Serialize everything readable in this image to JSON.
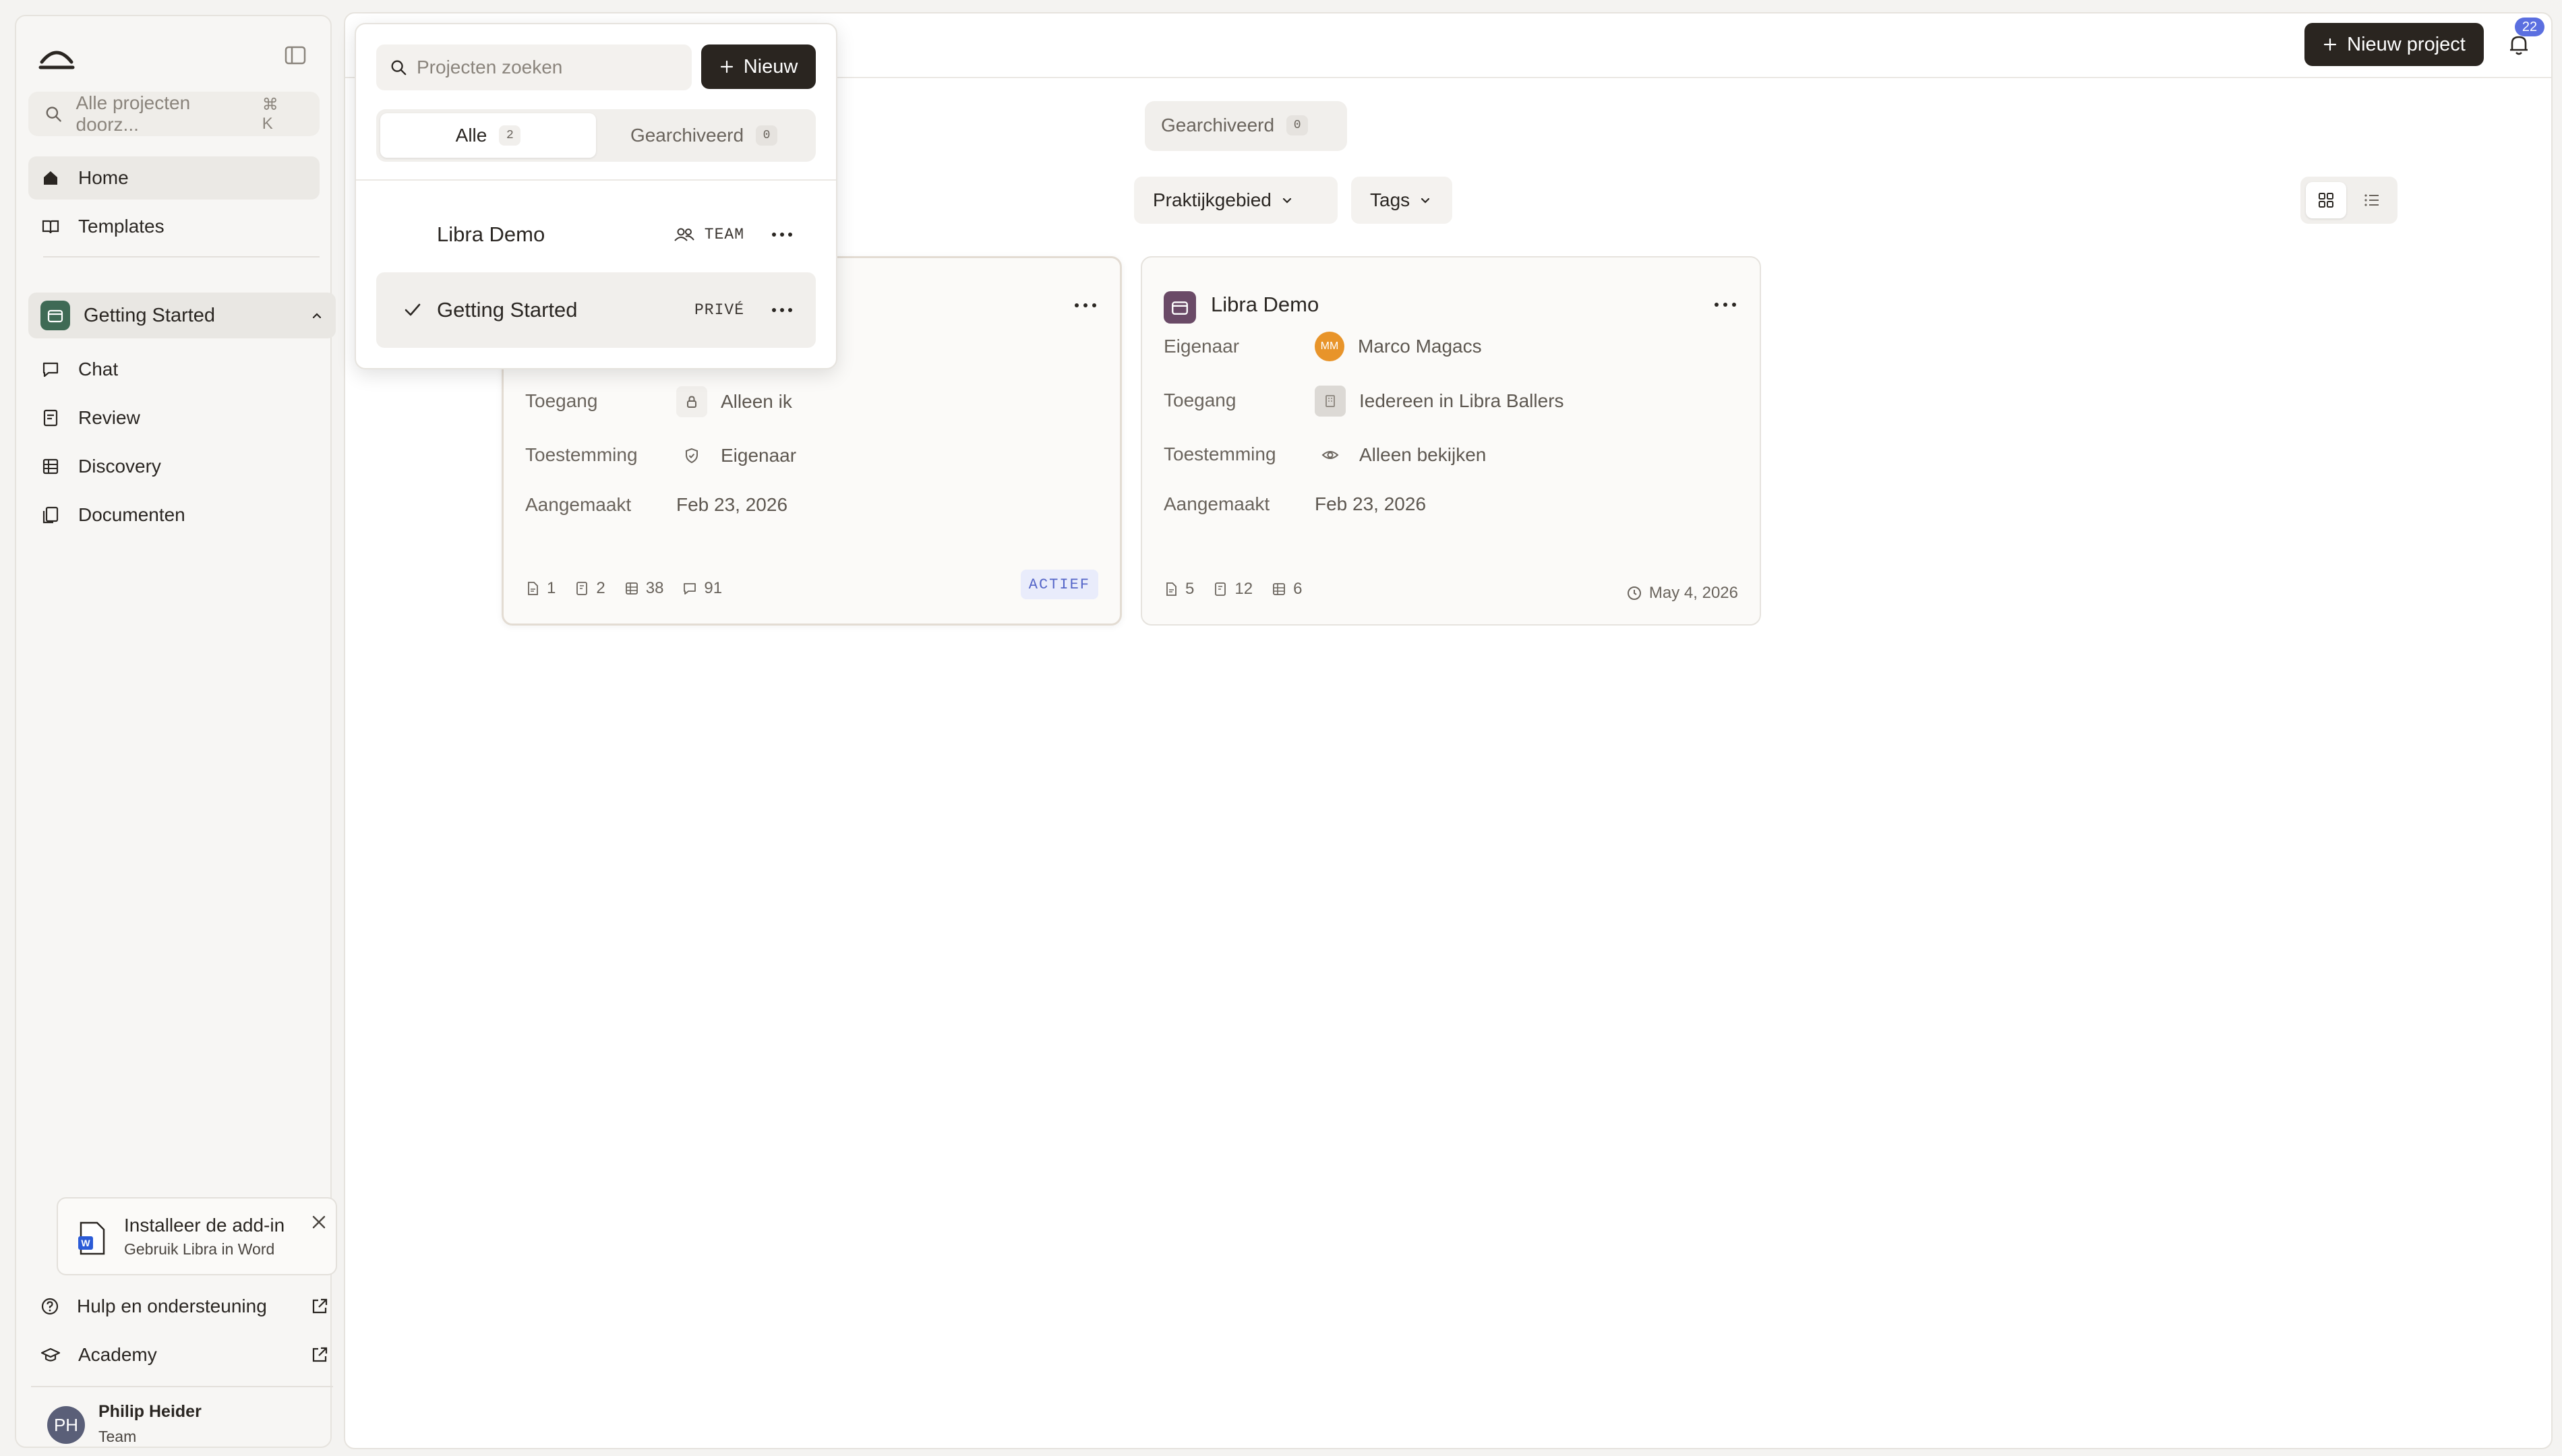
{
  "sidebar": {
    "search_placeholder": "Alle projecten doorz...",
    "search_shortcut": "⌘ K",
    "nav": [
      {
        "label": "Home",
        "icon": "home-icon",
        "active": true
      },
      {
        "label": "Templates",
        "icon": "book-icon",
        "active": false
      }
    ],
    "current_project": "Getting Started",
    "project_nav": [
      {
        "label": "Chat",
        "icon": "chat-icon"
      },
      {
        "label": "Review",
        "icon": "review-icon"
      },
      {
        "label": "Discovery",
        "icon": "table-icon"
      },
      {
        "label": "Documenten",
        "icon": "documents-icon"
      }
    ],
    "addin": {
      "title": "Installeer de add-in",
      "subtitle": "Gebruik Libra in Word"
    },
    "links": [
      {
        "label": "Hulp en ondersteuning",
        "icon": "help-icon"
      },
      {
        "label": "Academy",
        "icon": "graduation-cap-icon"
      }
    ],
    "user": {
      "initials": "PH",
      "name": "Philip Heider",
      "role": "Team"
    }
  },
  "header": {
    "new_project_label": "Nieuw project",
    "notification_count": "22"
  },
  "filters": {
    "archived_tab_label": "Gearchiveerd",
    "archived_count": "0",
    "practice_area_label": "Praktijkgebied",
    "tags_label": "Tags"
  },
  "cards": [
    {
      "title": "Getting Started",
      "rows": [
        {
          "label": "Toegang",
          "value": "Alleen ik"
        },
        {
          "label": "Toestemming",
          "value": "Eigenaar"
        },
        {
          "label": "Aangemaakt",
          "value": "Feb 23, 2026"
        }
      ],
      "stats": {
        "files": "1",
        "reviews": "2",
        "tables": "38",
        "chats": "91"
      },
      "badge": "ACTIEF"
    },
    {
      "title": "Libra Demo",
      "rows": [
        {
          "label": "Eigenaar",
          "value": "Marco Magacs",
          "avatar": "MM"
        },
        {
          "label": "Toegang",
          "value": "Iedereen in Libra Ballers"
        },
        {
          "label": "Toestemming",
          "value": "Alleen bekijken"
        },
        {
          "label": "Aangemaakt",
          "value": "Feb 23, 2026"
        }
      ],
      "stats": {
        "files": "5",
        "reviews": "12",
        "tables": "6"
      },
      "date": "May 4, 2026"
    }
  ],
  "popover": {
    "search_placeholder": "Projecten zoeken",
    "new_label": "Nieuw",
    "tabs": [
      {
        "label": "Alle",
        "count": "2",
        "active": true
      },
      {
        "label": "Gearchiveerd",
        "count": "0",
        "active": false
      }
    ],
    "projects": [
      {
        "name": "Libra Demo",
        "visibility": "TEAM",
        "selected": false
      },
      {
        "name": "Getting Started",
        "visibility": "PRIVÉ",
        "selected": true
      }
    ]
  },
  "colors": {
    "primary_button": "#2a2520",
    "project_icon_green": "#3f6a55",
    "project_icon_purple": "#6a4a67",
    "badge_blue": "#5b6fe0",
    "owner_avatar_orange": "#e8942a"
  }
}
